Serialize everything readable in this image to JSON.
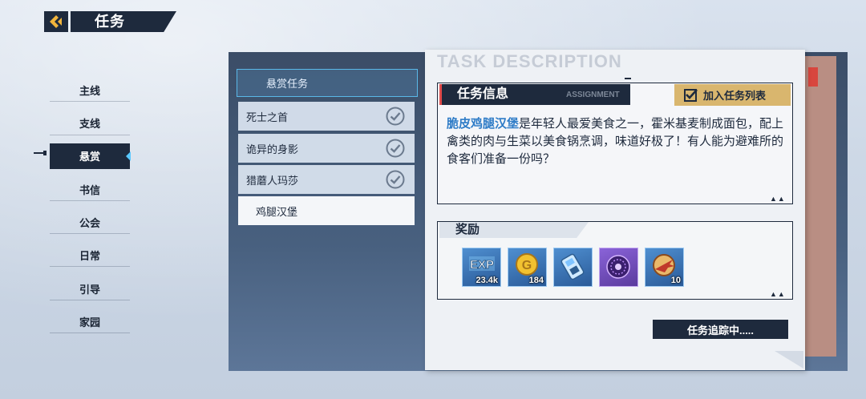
{
  "header": {
    "title": "任务"
  },
  "nav": {
    "items": [
      {
        "label": "主线"
      },
      {
        "label": "支线"
      },
      {
        "label": "悬赏"
      },
      {
        "label": "书信"
      },
      {
        "label": "公会"
      },
      {
        "label": "日常"
      },
      {
        "label": "引导"
      },
      {
        "label": "家园"
      }
    ],
    "active_index": 2
  },
  "task_list": {
    "header": "悬赏任务",
    "items": [
      {
        "label": "死士之首",
        "completed": true
      },
      {
        "label": "诡异的身影",
        "completed": true
      },
      {
        "label": "猎蘑人玛莎",
        "completed": true
      },
      {
        "label": "鸡腿汉堡",
        "completed": false,
        "selected": true
      }
    ]
  },
  "card": {
    "watermark": "TASK DESCRIPTION",
    "info_title": "任务信息",
    "info_tag": "ASSIGNMENT",
    "add_button": "加入任务列表",
    "desc_highlight": "脆皮鸡腿汉堡",
    "desc_rest": "是年轻人最爱美食之一，霍米基麦制成面包，配上禽类的肉与生菜以美食锅烹调，味道好极了！有人能为避难所的食客们准备一份吗？",
    "reward_title": "奖励",
    "rewards": [
      {
        "icon": "exp-icon",
        "count": "23.4k"
      },
      {
        "icon": "gold-coin-icon",
        "count": "184"
      },
      {
        "icon": "chip-card-icon",
        "count": ""
      },
      {
        "icon": "purple-orb-icon",
        "count": ""
      },
      {
        "icon": "plane-badge-icon",
        "count": "10"
      }
    ],
    "track_button": "任务追踪中....."
  },
  "colors": {
    "accent_dark": "#1e2a3d",
    "highlight_blue": "#2f7cc7",
    "gold": "#d9b66e",
    "red": "#e14a4a"
  }
}
